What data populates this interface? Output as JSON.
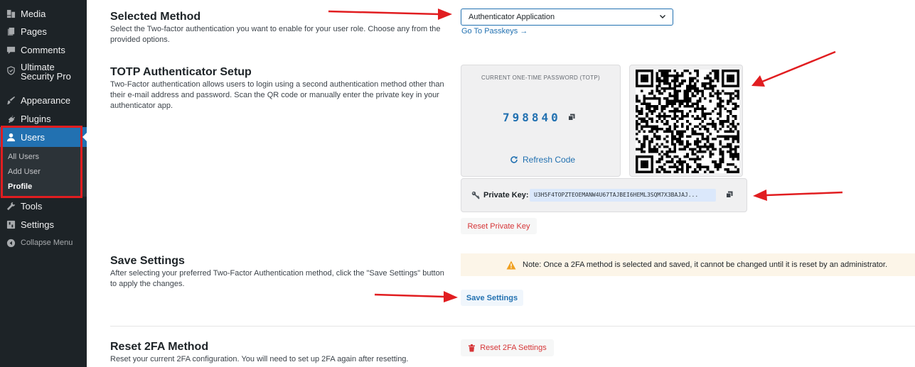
{
  "sidebar": {
    "items": [
      {
        "label": "Media",
        "icon": "media-icon"
      },
      {
        "label": "Pages",
        "icon": "pages-icon"
      },
      {
        "label": "Comments",
        "icon": "comments-icon"
      },
      {
        "label": "Ultimate Security Pro",
        "line1": "Ultimate",
        "line2": "Security Pro",
        "icon": "shield-icon"
      },
      {
        "label": "Appearance",
        "icon": "appearance-icon"
      },
      {
        "label": "Plugins",
        "icon": "plugins-icon"
      },
      {
        "label": "Users",
        "icon": "user-icon",
        "active": true
      },
      {
        "label": "Tools",
        "icon": "tools-icon"
      },
      {
        "label": "Settings",
        "icon": "settings-icon"
      }
    ],
    "users_submenu": [
      "All Users",
      "Add User",
      "Profile"
    ],
    "current_submenu": "Profile",
    "collapse_label": "Collapse Menu"
  },
  "selected_method": {
    "title": "Selected Method",
    "description": "Select the Two-factor authentication you want to enable for your user role. Choose any from the provided options.",
    "select_value": "Authenticator Application",
    "passkeys_link": "Go To Passkeys →"
  },
  "totp_setup": {
    "title": "TOTP Authenticator Setup",
    "description": "Two-Factor authentication allows users to login using a second authentication method other than their e-mail address and password. Scan the QR code or manually enter the private key in your authenticator app.",
    "otp_label": "CURRENT ONE-TIME PASSWORD (TOTP)",
    "otp_code": "798840",
    "refresh_label": "Refresh Code",
    "private_key_label": "Private Key:",
    "private_key_value": "U3H5F4TOPZTEOEMANW4U67TAJBEI6HEML3SQM7X3BAJAJ...",
    "reset_private_key_label": "Reset Private Key"
  },
  "save_settings": {
    "title": "Save Settings",
    "description": "After selecting your preferred Two-Factor Authentication method, click the \"Save Settings\" button to apply the changes.",
    "notice": "Note: Once a 2FA method is selected and saved, it cannot be changed until it is reset by an administrator.",
    "button_label": "Save Settings"
  },
  "reset_2fa": {
    "title": "Reset 2FA Method",
    "description": "Reset your current 2FA configuration. You will need to set up 2FA again after resetting.",
    "button_label": "Reset 2FA Settings"
  },
  "colors": {
    "sidebar_bg": "#1d2327",
    "accent": "#2271b1",
    "danger": "#d63638",
    "annotation_red": "#e11d20",
    "notice_bg": "#fcf5e8"
  }
}
